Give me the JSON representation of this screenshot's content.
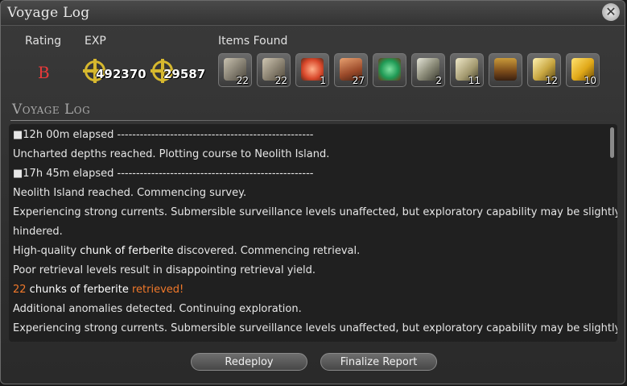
{
  "window": {
    "title": "Voyage Log"
  },
  "header": {
    "rating_label": "Rating",
    "exp_label": "EXP",
    "items_label": "Items Found",
    "rating_value": "B",
    "exp_values": [
      "492370",
      "29587"
    ]
  },
  "items": [
    {
      "icon": "ore-chunk-icon",
      "count": "22"
    },
    {
      "icon": "ore-chunk-icon",
      "count": "22"
    },
    {
      "icon": "coral-icon",
      "count": "1"
    },
    {
      "icon": "log-icon",
      "count": "27"
    },
    {
      "icon": "green-crystal-icon",
      "count": ""
    },
    {
      "icon": "crystal-shard-icon",
      "count": "2"
    },
    {
      "icon": "silver-ingot-icon",
      "count": "11"
    },
    {
      "icon": "treasure-chest-icon",
      "count": ""
    },
    {
      "icon": "gold-ore-icon",
      "count": "12"
    },
    {
      "icon": "gold-ingot-icon",
      "count": "10"
    }
  ],
  "log": {
    "section_title": "Voyage Log",
    "lines": [
      {
        "a": "■12h 00m elapsed    ----------------------------------------------------"
      },
      {
        "a": "Uncharted depths reached. Plotting course to Neolith Island."
      },
      {
        "a": "■17h 45m elapsed    ----------------------------------------------------"
      },
      {
        "a": "Neolith Island reached. Commencing survey."
      },
      {
        "a": "Experiencing strong currents. Submersible surveillance levels unaffected, but exploratory capability may be slightly"
      },
      {
        "a": "hindered."
      },
      {
        "a": "High-quality ",
        "b": "chunk of ferberite",
        "c": " discovered. Commencing retrieval."
      },
      {
        "a": "Poor retrieval levels result in disappointing retrieval yield."
      },
      {
        "a": "22",
        "b": " chunks of ferberite ",
        "c": "retrieved!"
      },
      {
        "a": "Additional anomalies detected. Continuing exploration."
      },
      {
        "a": "Experiencing strong currents. Submersible surveillance levels unaffected, but exploratory capability may be slightly"
      }
    ]
  },
  "buttons": {
    "redeploy": "Redeploy",
    "finalize": "Finalize Report"
  }
}
